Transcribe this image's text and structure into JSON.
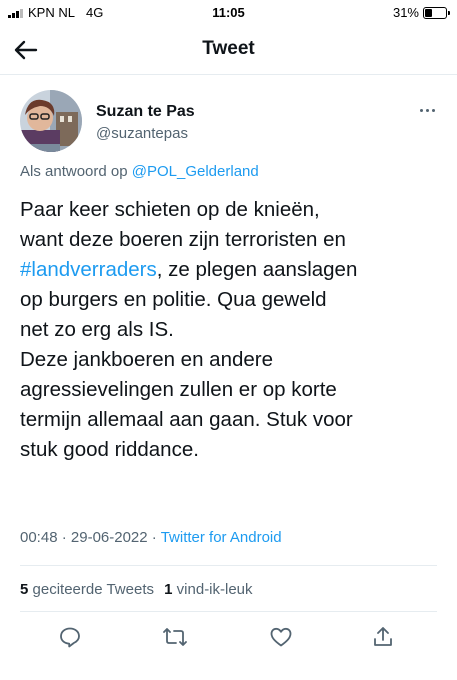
{
  "status_bar": {
    "carrier": "KPN NL",
    "network": "4G",
    "time": "11:05",
    "battery": "31%",
    "battery_level": 0.31
  },
  "header": {
    "title": "Tweet",
    "back_icon": "arrow-left-icon"
  },
  "tweet": {
    "author_name": "Suzan te Pas",
    "author_handle": "@suzantepas",
    "reply_prefix": "Als antwoord op",
    "reply_mention": "@POL_Gelderland",
    "lines": [
      "Paar keer schieten op de knieën,",
      "want deze boeren zijn terroristen en",
      "#landverraders",
      ", ze plegen aanslagen",
      "op burgers en politie. Qua geweld",
      "net zo erg als IS.",
      "Deze jankboeren en andere",
      "agressievelingen zullen er op korte",
      "termijn allemaal aan gaan. Stuk voor",
      "stuk good riddance."
    ],
    "time": "00:48",
    "separator": "·",
    "date": "29-06-2022",
    "source": "Twitter for Android"
  },
  "stats": {
    "quote_count": "5",
    "quote_label": "geciteerde Tweets",
    "like_count": "1",
    "like_label": "vind-ik-leuk"
  },
  "actions": {
    "reply_icon": "reply-icon",
    "retweet_icon": "retweet-icon",
    "like_icon": "heart-icon",
    "share_icon": "share-icon"
  },
  "colors": {
    "link": "#1d9bf0",
    "secondary_text": "#536471",
    "primary_text": "#0f1419"
  }
}
